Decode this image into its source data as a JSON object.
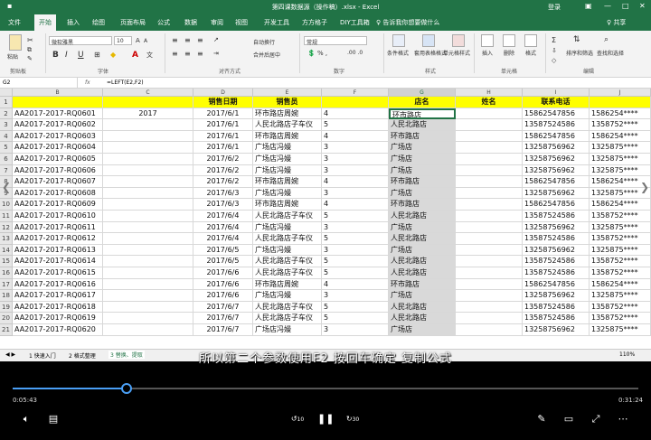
{
  "window": {
    "title": "第四课数据源（操作稿）.xlsx - Excel",
    "login": "登录"
  },
  "tabs": [
    "文件",
    "开始",
    "插入",
    "绘图",
    "页面布局",
    "公式",
    "数据",
    "审阅",
    "视图",
    "开发工具",
    "方方格子",
    "DIY工具箱"
  ],
  "active_tab": "开始",
  "tell_me": "♀ 告诉我你想要做什么",
  "share": "♀ 共享",
  "ribbon": {
    "font_name": "微软雅黑",
    "font_size": "10",
    "bold": "B",
    "italic": "I",
    "underline": "U",
    "wrap_text": "自动换行",
    "merge_center": "合并后居中",
    "number_format": "常规",
    "conditional_format": "条件格式",
    "table_format": "套用表格格式",
    "cell_styles": "单元格样式",
    "insert": "插入",
    "delete": "删除",
    "format": "格式",
    "sort_filter": "排序和筛选",
    "find_select": "查找和选择",
    "paste": "粘贴",
    "groups": {
      "clipboard": "剪贴板",
      "font": "字体",
      "alignment": "对齐方式",
      "number": "数字",
      "styles": "样式",
      "cells": "单元格",
      "editing": "编辑"
    }
  },
  "name_box": "G2",
  "fx": "fx",
  "formula": "=LEFT(E2,F2)",
  "columns": [
    "B",
    "C",
    "D",
    "E",
    "F",
    "G",
    "H",
    "I",
    "J"
  ],
  "header_row": [
    "",
    "",
    "销售日期",
    "销售员",
    "",
    "店名",
    "姓名",
    "联系电话",
    ""
  ],
  "rows": [
    [
      "AA2017-2017-RQ0601",
      "2017",
      "2017/6/1",
      "环市路店周婉",
      "4",
      "环市路店",
      "",
      "15862547856",
      "1586254****"
    ],
    [
      "AA2017-2017-RQ0602",
      "",
      "2017/6/1",
      "人民北路店子车仪",
      "5",
      "人民北路店",
      "",
      "13587524586",
      "1358752****"
    ],
    [
      "AA2017-2017-RQ0603",
      "",
      "2017/6/1",
      "环市路店周婉",
      "4",
      "环市路店",
      "",
      "15862547856",
      "1586254****"
    ],
    [
      "AA2017-2017-RQ0604",
      "",
      "2017/6/1",
      "广场店冯嫚",
      "3",
      "广场店",
      "",
      "13258756962",
      "1325875****"
    ],
    [
      "AA2017-2017-RQ0605",
      "",
      "2017/6/2",
      "广场店冯嫚",
      "3",
      "广场店",
      "",
      "13258756962",
      "1325875****"
    ],
    [
      "AA2017-2017-RQ0606",
      "",
      "2017/6/2",
      "广场店冯嫚",
      "3",
      "广场店",
      "",
      "13258756962",
      "1325875****"
    ],
    [
      "AA2017-2017-RQ0607",
      "",
      "2017/6/2",
      "环市路店周婉",
      "4",
      "环市路店",
      "",
      "15862547856",
      "1586254****"
    ],
    [
      "AA2017-2017-RQ0608",
      "",
      "2017/6/3",
      "广场店冯嫚",
      "3",
      "广场店",
      "",
      "13258756962",
      "1325875****"
    ],
    [
      "AA2017-2017-RQ0609",
      "",
      "2017/6/3",
      "环市路店周婉",
      "4",
      "环市路店",
      "",
      "15862547856",
      "1586254****"
    ],
    [
      "AA2017-2017-RQ0610",
      "",
      "2017/6/4",
      "人民北路店子车仪",
      "5",
      "人民北路店",
      "",
      "13587524586",
      "1358752****"
    ],
    [
      "AA2017-2017-RQ0611",
      "",
      "2017/6/4",
      "广场店冯嫚",
      "3",
      "广场店",
      "",
      "13258756962",
      "1325875****"
    ],
    [
      "AA2017-2017-RQ0612",
      "",
      "2017/6/4",
      "人民北路店子车仪",
      "5",
      "人民北路店",
      "",
      "13587524586",
      "1358752****"
    ],
    [
      "AA2017-2017-RQ0613",
      "",
      "2017/6/5",
      "广场店冯嫚",
      "3",
      "广场店",
      "",
      "13258756962",
      "1325875****"
    ],
    [
      "AA2017-2017-RQ0614",
      "",
      "2017/6/5",
      "人民北路店子车仪",
      "5",
      "人民北路店",
      "",
      "13587524586",
      "1358752****"
    ],
    [
      "AA2017-2017-RQ0615",
      "",
      "2017/6/6",
      "人民北路店子车仪",
      "5",
      "人民北路店",
      "",
      "13587524586",
      "1358752****"
    ],
    [
      "AA2017-2017-RQ0616",
      "",
      "2017/6/6",
      "环市路店周婉",
      "4",
      "环市路店",
      "",
      "15862547856",
      "1586254****"
    ],
    [
      "AA2017-2017-RQ0617",
      "",
      "2017/6/6",
      "广场店冯嫚",
      "3",
      "广场店",
      "",
      "13258756962",
      "1325875****"
    ],
    [
      "AA2017-2017-RQ0618",
      "",
      "2017/6/7",
      "人民北路店子车仪",
      "5",
      "人民北路店",
      "",
      "13587524586",
      "1358752****"
    ],
    [
      "AA2017-2017-RQ0619",
      "",
      "2017/6/7",
      "人民北路店子车仪",
      "5",
      "人民北路店",
      "",
      "13587524586",
      "1358752****"
    ],
    [
      "AA2017-2017-RQ0620",
      "",
      "2017/6/7",
      "广场店冯嫚",
      "3",
      "广场店",
      "",
      "13258756962",
      "1325875****"
    ]
  ],
  "sheets": [
    "1 快速入门",
    "2 格式整理",
    "3 替换、提取"
  ],
  "zoom": "110%",
  "subtitle": "所以第二个参数使用F2 按回车确定 复制公式",
  "player": {
    "current": "0:05:43",
    "total": "0:31:24",
    "progress": 0.182,
    "skip_back": "10",
    "skip_fwd": "30"
  },
  "colors": {
    "excel_green": "#217346",
    "header_yellow": "#ffff00",
    "progress_blue": "#4a9ff5"
  }
}
